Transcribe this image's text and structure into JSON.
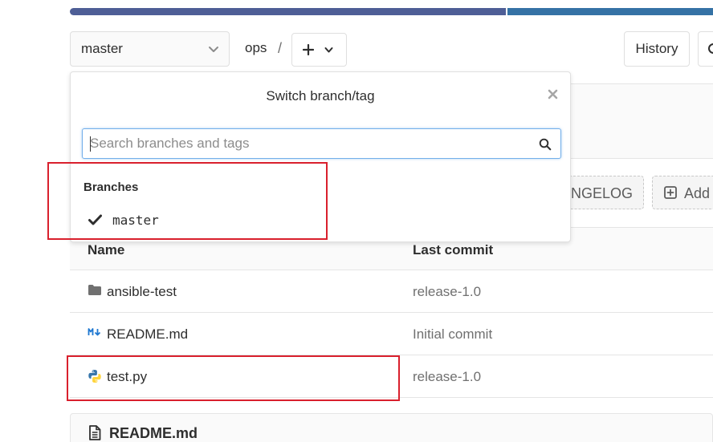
{
  "colors": {
    "lang_bar_primary": "#4e5e96",
    "lang_bar_secondary": "#3572a5",
    "highlight": "#d9202d",
    "search_focus": "#73afea"
  },
  "toolbar": {
    "branch": "master",
    "breadcrumb_project": "ops",
    "breadcrumb_separator": "/",
    "history_label": "History"
  },
  "dropdown": {
    "title": "Switch branch/tag",
    "search_placeholder": "Search branches and tags",
    "section_label": "Branches",
    "branches": [
      {
        "name": "master",
        "selected": true
      }
    ]
  },
  "buttons": {
    "changelog_label": "ANGELOG",
    "add_label": "Add"
  },
  "files": {
    "columns": {
      "name": "Name",
      "last_commit": "Last commit"
    },
    "rows": [
      {
        "name": "ansible-test",
        "type": "folder",
        "icon": "folder-icon",
        "commit": "release-1.0"
      },
      {
        "name": "README.md",
        "type": "markdown",
        "icon": "markdown-icon",
        "commit": "Initial commit"
      },
      {
        "name": "test.py",
        "type": "python",
        "icon": "python-icon",
        "commit": "release-1.0"
      }
    ]
  },
  "readme": {
    "title": "README.md"
  }
}
